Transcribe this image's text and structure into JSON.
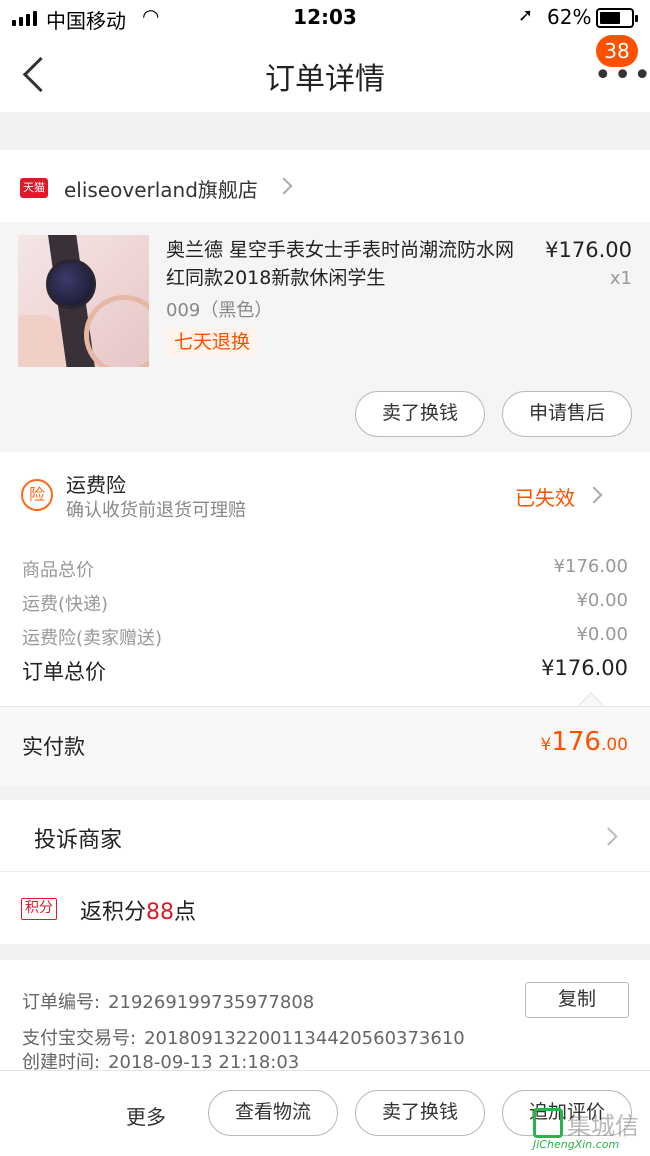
{
  "status_bar": {
    "carrier": "中国移动",
    "time": "12:03",
    "battery": "62%"
  },
  "nav": {
    "title": "订单详情",
    "badge": "38"
  },
  "store": {
    "badge": "天猫",
    "name": "eliseoverland旗舰店"
  },
  "product": {
    "title": "奥兰德 星空手表女士手表时尚潮流防水网红同款2018新款休闲学生",
    "price": "¥176.00",
    "qty": "x1",
    "sku": "009（黑色）",
    "tag": "七天退换",
    "sell_button": "卖了换钱",
    "aftersale_button": "申请售后"
  },
  "insurance": {
    "title": "运费险",
    "subtitle": "确认收货前退货可理赔",
    "status": "已失效",
    "icon": "险"
  },
  "summary": {
    "rows": [
      {
        "label": "商品总价",
        "value": "¥176.00"
      },
      {
        "label": "运费(快递)",
        "value": "¥0.00"
      },
      {
        "label": "运费险(卖家赠送)",
        "value": "¥0.00"
      }
    ],
    "total_label": "订单总价",
    "total_value": "¥176.00"
  },
  "paid": {
    "label": "实付款",
    "currency": "¥",
    "integer": "176",
    "decimal": ".00"
  },
  "complaint": {
    "label": "投诉商家"
  },
  "points": {
    "badge": "积分",
    "prefix": "返积分",
    "value": "88",
    "suffix": "点"
  },
  "order_info": {
    "order_no_label": "订单编号:",
    "order_no": "219269199735977808",
    "copy_button": "复制",
    "alipay_label": "支付宝交易号:",
    "alipay_no": "2018091322001134420560373610",
    "created_label": "创建时间:",
    "created": "2018-09-13 21:18:03"
  },
  "bottom_bar": {
    "more": "更多",
    "logistics_button": "查看物流",
    "sell_button": "卖了换钱",
    "review_button": "追加评价"
  },
  "watermark": {
    "text": "集城信",
    "sub": "JiChengXin.com"
  },
  "colors": {
    "accent": "#ff5000",
    "tmall_red": "#e0182a"
  }
}
